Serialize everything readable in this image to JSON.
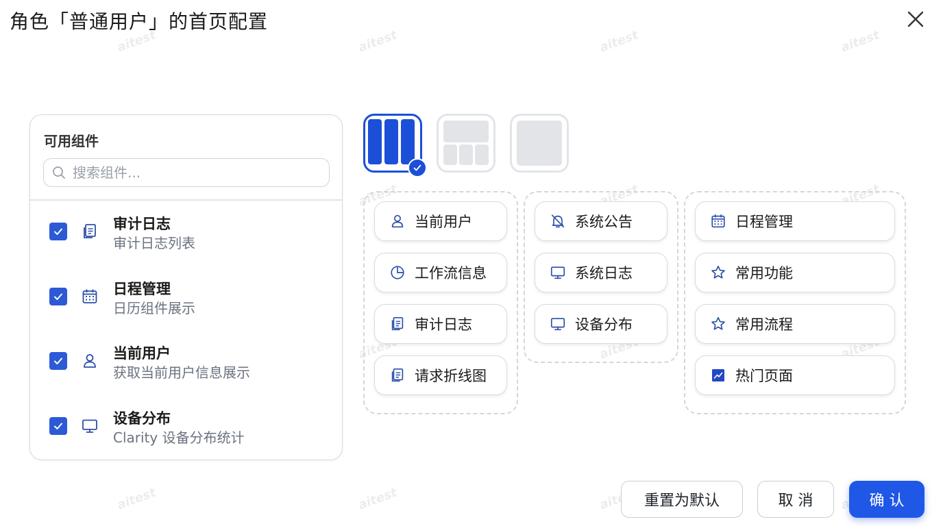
{
  "dialog": {
    "title": "角色「普通用户」的首页配置",
    "watermark": "aitest"
  },
  "left_panel": {
    "title": "可用组件",
    "search_placeholder": "搜索组件...",
    "items": [
      {
        "name": "审计日志",
        "desc": "审计日志列表",
        "icon": "document-icon",
        "checked": true
      },
      {
        "name": "日程管理",
        "desc": "日历组件展示",
        "icon": "calendar-icon",
        "checked": true
      },
      {
        "name": "当前用户",
        "desc": "获取当前用户信息展示",
        "icon": "user-icon",
        "checked": true
      },
      {
        "name": "设备分布",
        "desc": "Clarity 设备分布统计",
        "icon": "monitor-icon",
        "checked": true
      }
    ]
  },
  "layouts": {
    "options": [
      "three-column-layout",
      "grid-layout",
      "single-layout"
    ],
    "selected": "three-column-layout"
  },
  "columns": [
    {
      "widgets": [
        {
          "label": "当前用户",
          "icon": "user-icon"
        },
        {
          "label": "工作流信息",
          "icon": "pie-chart-icon"
        },
        {
          "label": "审计日志",
          "icon": "document-icon"
        },
        {
          "label": "请求折线图",
          "icon": "document-icon"
        }
      ]
    },
    {
      "widgets": [
        {
          "label": "系统公告",
          "icon": "bell-off-icon"
        },
        {
          "label": "系统日志",
          "icon": "monitor-icon"
        },
        {
          "label": "设备分布",
          "icon": "monitor-icon"
        }
      ]
    },
    {
      "widgets": [
        {
          "label": "日程管理",
          "icon": "calendar-icon"
        },
        {
          "label": "常用功能",
          "icon": "star-icon"
        },
        {
          "label": "常用流程",
          "icon": "star-icon"
        },
        {
          "label": "热门页面",
          "icon": "trend-chart-icon"
        }
      ]
    }
  ],
  "footer": {
    "reset_label": "重置为默认",
    "cancel_label": "取 消",
    "confirm_label": "确 认"
  },
  "colors": {
    "primary": "#1f57e7",
    "checkbox": "#2c5ad6",
    "icon": "#2b4fa8"
  }
}
